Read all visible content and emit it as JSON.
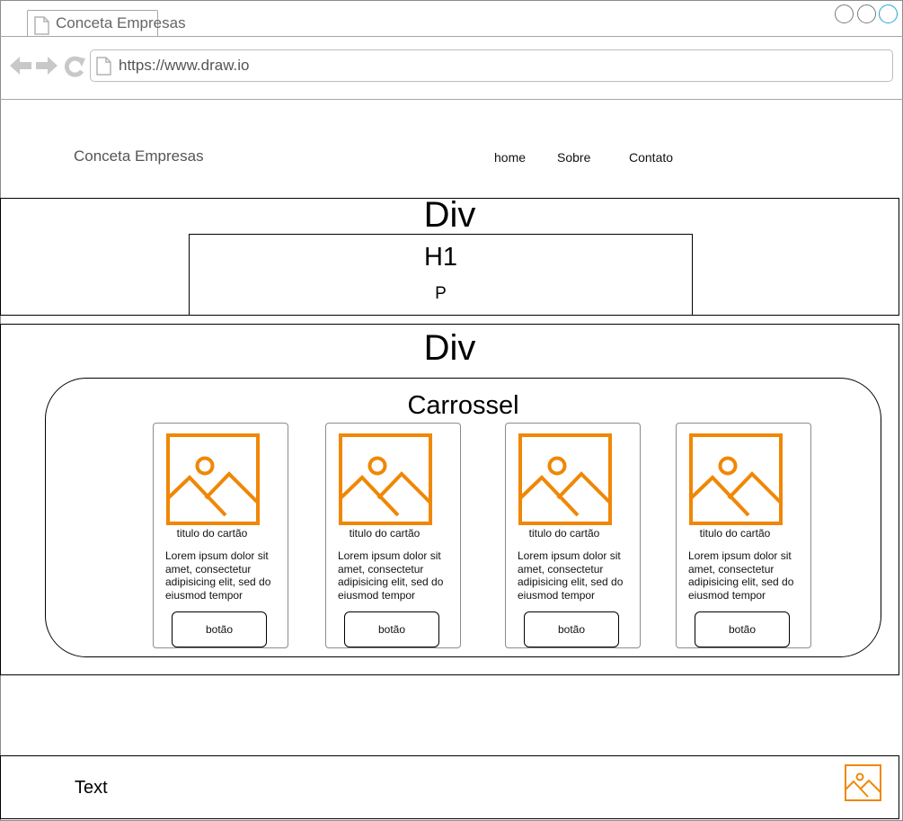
{
  "browser": {
    "tab_title": "Conceta Empresas",
    "url": "https://www.draw.io",
    "accent_color": "#29a3d6"
  },
  "header": {
    "brand": "Conceta Empresas",
    "nav": [
      "home",
      "Sobre",
      "Contato"
    ]
  },
  "hero": {
    "div_label": "Div",
    "h1_label": "H1",
    "p_label": "P"
  },
  "section": {
    "div_label": "Div",
    "carousel_title": "Carrossel",
    "cards": [
      {
        "title": "titulo do cartão",
        "text": "Lorem ipsum dolor sit amet, consectetur adipisicing elit, sed do eiusmod tempor",
        "button": "botão"
      },
      {
        "title": "titulo do cartão",
        "text": "Lorem ipsum dolor sit amet, consectetur adipisicing elit, sed do eiusmod tempor",
        "button": "botão"
      },
      {
        "title": "titulo do cartão",
        "text": "Lorem ipsum dolor sit amet, consectetur adipisicing elit, sed do eiusmod tempor",
        "button": "botão"
      },
      {
        "title": "titulo do cartão",
        "text": "Lorem ipsum dolor sit amet, consectetur adipisicing elit, sed do eiusmod tempor",
        "button": "botão"
      }
    ]
  },
  "footer": {
    "text": "Text"
  },
  "colors": {
    "image_placeholder": "#f08705"
  },
  "icons": {
    "image_placeholder": "image-placeholder-icon",
    "back": "back-arrow-icon",
    "forward": "forward-arrow-icon",
    "reload": "reload-icon",
    "page": "page-icon"
  }
}
